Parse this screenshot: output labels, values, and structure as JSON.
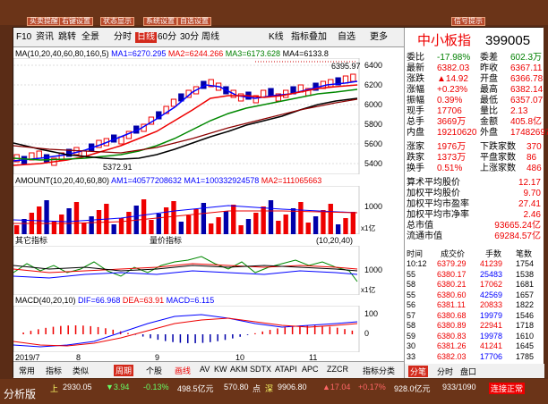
{
  "topbar": [
    "买卖提醒",
    "右键设置",
    "状态显示",
    "系统设置",
    "自选设置",
    "信号提示"
  ],
  "toolbar": {
    "f10": "F10",
    "news": "资讯",
    "jump": "跳转",
    "fullscreen": "全景",
    "fen": "分时",
    "rixian": "日线",
    "m60": "60分",
    "m30": "30分",
    "period": "周线",
    "tabs_more": "K线",
    "indicator": "指标叠加",
    "self": "自选",
    "more": "更多"
  },
  "ma_legend": {
    "name": "MA",
    "params": "(10,20,40,60,80,160,5)",
    "ma1": "MA1=6270.295",
    "ma2": "MA2=6244.266",
    "ma3": "MA3=6173.628",
    "ma4": "MA4=6133.8"
  },
  "amount_legend": {
    "name": "AMOUNT",
    "params": "(10,20,40,60,80)",
    "am1": "AM1=40577208632",
    "ma1": "MA1=100332924578",
    "ma2": "MA2=111065663"
  },
  "mid_legend": {
    "name": "其它指标",
    "center": "量价指标",
    "params": "(10,20,40)"
  },
  "macd_legend": {
    "name": "MACD",
    "params": "(40,20,10)",
    "dif": "DIF=66.968",
    "dea": "DEA=63.91",
    "macd": "MACD=6.115"
  },
  "price_labels": [
    "6400",
    "6200",
    "6000",
    "5800",
    "5600",
    "5400"
  ],
  "high_label": "6395.97",
  "low_label": "5372.91",
  "amount_axis": [
    "1000"
  ],
  "amount_unit": "x1亿",
  "mid_axis": [
    "1000"
  ],
  "mid_unit": "x1亿",
  "macd_axis": [
    "100",
    "0"
  ],
  "date_labels": [
    "2019/7",
    "8",
    "9",
    "10",
    "11"
  ],
  "bottom_tabs": [
    "常用",
    "指标",
    "类似",
    "周期",
    "个股",
    "画线",
    "AV",
    "KW",
    "AKM",
    "SDTX",
    "ATAPI",
    "APC",
    "ZZCR",
    "指标分类"
  ],
  "quote": {
    "title": "中小板指",
    "code": "399005",
    "rows": [
      [
        "委比",
        "-17.98%",
        "委差",
        "602.3万"
      ],
      [
        "最新",
        "6382.03",
        "昨收",
        "6367.11"
      ],
      [
        "涨跌",
        "▲14.92",
        "开盘",
        "6366.78"
      ],
      [
        "涨幅",
        "+0.23%",
        "最高",
        "6382.14"
      ],
      [
        "振幅",
        "0.39%",
        "最低",
        "6357.07"
      ],
      [
        "现手",
        "17706",
        "量比",
        "2.13"
      ],
      [
        "总手",
        "3669万",
        "金额",
        "405.8亿"
      ],
      [
        "内盘",
        "19210620",
        "外盘",
        "17482697"
      ]
    ],
    "updown": [
      [
        "涨家",
        "1976万",
        "下跌家数",
        "370"
      ],
      [
        "跌家",
        "1373万",
        "平盘家数",
        "86"
      ],
      [
        "换手",
        "0.51%",
        "上涨家数",
        "486"
      ]
    ],
    "stats": [
      [
        "算术平均股价",
        "12.17"
      ],
      [
        "加权平均股价",
        "9.70"
      ],
      [
        "加权平均市盈率",
        "27.41"
      ],
      [
        "加权平均市净率",
        "2.46"
      ],
      [
        "总市值",
        "93665.24亿"
      ],
      [
        "流通市值",
        "69284.57亿"
      ]
    ],
    "tick_header": [
      "时间",
      "成交价",
      "手数",
      "笔数"
    ],
    "ticks": [
      [
        "10:12",
        "6379.29",
        "41239",
        "1754"
      ],
      [
        "55",
        "6380.17",
        "25483",
        "1538"
      ],
      [
        "58",
        "6380.21",
        "17062",
        "1681"
      ],
      [
        "55",
        "6380.60",
        "42569",
        "1657"
      ],
      [
        "56",
        "6381.11",
        "20833",
        "1822"
      ],
      [
        "57",
        "6380.68",
        "19979",
        "1546"
      ],
      [
        "58",
        "6380.89",
        "22941",
        "1718"
      ],
      [
        "59",
        "6380.83",
        "19978",
        "1610"
      ],
      [
        "30",
        "6381.26",
        "41241",
        "1645"
      ],
      [
        "33",
        "6382.03",
        "17706",
        "1785"
      ]
    ],
    "tabs": [
      "分笔",
      "分时",
      "盘口"
    ]
  },
  "statusbar": {
    "sh": "上",
    "sh_val": "2930.05",
    "sh_chg": "▼3.94",
    "sh_pct": "-0.13%",
    "sh_amt": "498.5亿元",
    "sz_val": "570.80",
    "sz_chg": "点",
    "cy": "深",
    "cy_val": "9906.80",
    "cy_chg": "▲17.04",
    "cy_pct": "+0.17%",
    "cy_amt": "928.0亿元",
    "pages": "933/1090",
    "conn": "连接正常",
    "left": "分析版"
  },
  "chart_data": {
    "type": "candlestick",
    "x": [
      "2019/7",
      "8",
      "9",
      "10",
      "11"
    ],
    "high": 6395.97,
    "low": 5372.91,
    "ylim": [
      5300,
      6450
    ]
  }
}
